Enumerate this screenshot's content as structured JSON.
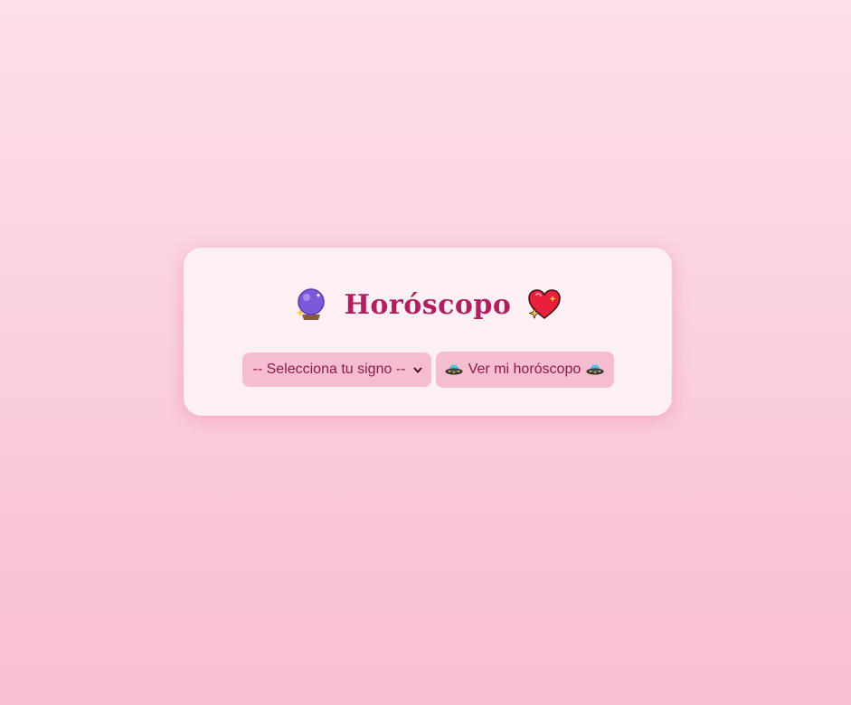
{
  "horoscope_card": {
    "title": "Horóscopo",
    "left_icon": "crystal-ball-icon",
    "right_icon": "sparkling-heart-icon"
  },
  "sign_select": {
    "selected": "-- Selecciona tu signo --"
  },
  "show_button": {
    "label": "Ver mi horóscopo",
    "icon": "flying-saucer-icon"
  },
  "colors": {
    "background_top": "#fde0ea",
    "background_bottom": "#f8bfd2",
    "card": "#fdf0f5",
    "title": "#b0205e",
    "control_bg": "#f6bcd0",
    "control_text": "#8a1c4d"
  }
}
